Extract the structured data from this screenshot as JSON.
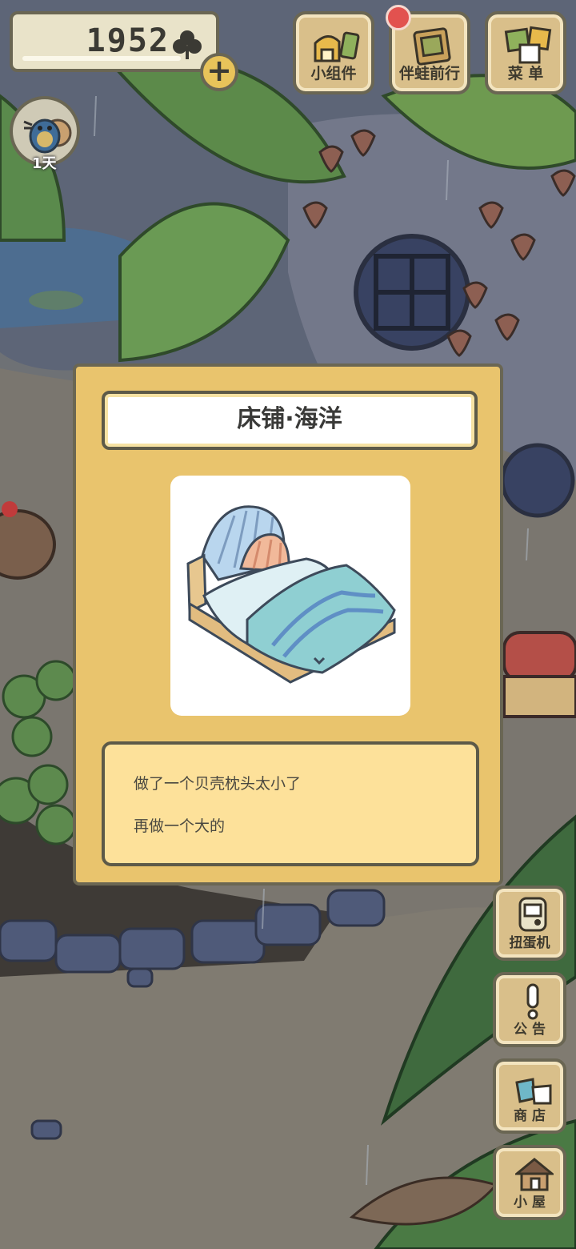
{
  "hud": {
    "clover_count": "1952",
    "plus_label": "+",
    "day_label": "1天"
  },
  "top_buttons": [
    {
      "label": "小组件",
      "icon": "widget-icon"
    },
    {
      "label": "伴蛙前行",
      "icon": "journal-icon"
    },
    {
      "label": "菜 单",
      "icon": "menu-icon"
    }
  ],
  "side_buttons": [
    {
      "label": "扭蛋机",
      "icon": "gacha-machine-icon"
    },
    {
      "label": "公 告",
      "icon": "exclamation-icon"
    },
    {
      "label": "商 店",
      "icon": "shop-bags-icon"
    },
    {
      "label": "小 屋",
      "icon": "house-icon"
    }
  ],
  "dialog": {
    "title": "床铺·海洋",
    "image_icon": "ocean-bed-icon",
    "description": [
      "做了一个贝壳枕头太小了",
      "再做一个大的"
    ]
  },
  "colors": {
    "dialog_bg": "#e9c46d",
    "description_bg": "#fde19a",
    "button_wood": "#d9bf8a",
    "outline": "#6a6653",
    "notify": "#e2524f"
  }
}
